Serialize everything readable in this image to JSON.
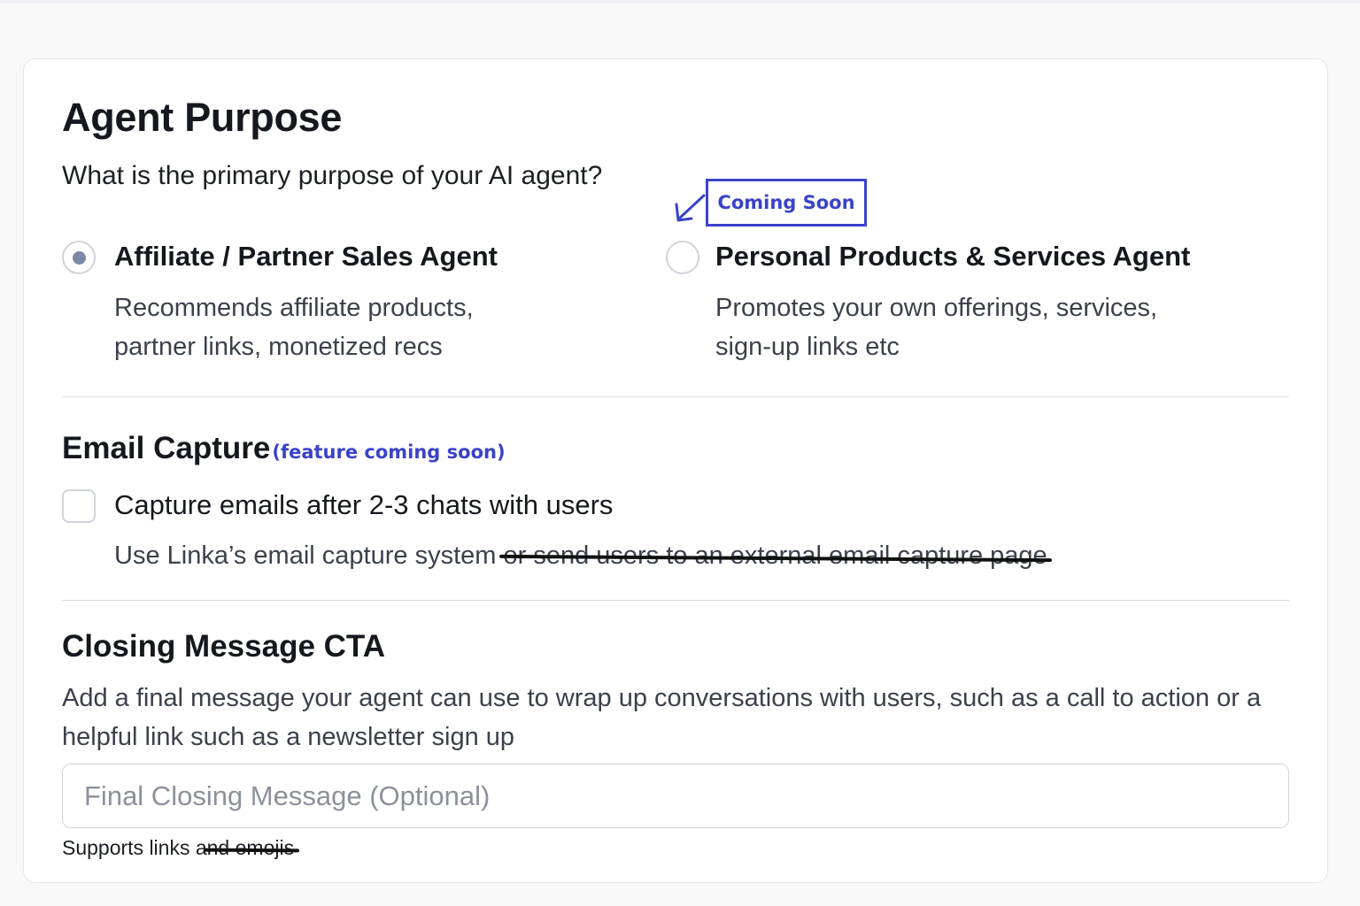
{
  "section_purpose": {
    "title": "Agent Purpose",
    "question": "What is the primary purpose of your AI agent?",
    "options": [
      {
        "title": "Affiliate / Partner Sales Agent",
        "desc_line1": "Recommends affiliate products,",
        "desc_line2": "partner links, monetized recs",
        "selected": true
      },
      {
        "title": "Personal Products & Services Agent",
        "desc_line1": "Promotes your own offerings, services,",
        "desc_line2": "sign-up links etc",
        "selected": false
      }
    ],
    "annotation": "Coming Soon"
  },
  "section_email": {
    "title": "Email Capture",
    "annotation": "(feature coming soon)",
    "checkbox_label": "Capture emails after 2-3 chats with users",
    "checked": false,
    "desc_plain": "Use Linka’s email capture system ",
    "desc_struck": "or send users to an external email capture page"
  },
  "section_cta": {
    "title": "Closing Message CTA",
    "desc": "Add a final message your agent can use to wrap up conversations with users, such as a call to action or a helpful link such as a newsletter sign up",
    "input_placeholder": "Final Closing Message (Optional)",
    "input_value": "",
    "hint_plain": "Supports links a",
    "hint_struck": "nd emojis"
  },
  "colors": {
    "annotation_blue": "#3a43c9",
    "radio_selected": "#7d87a6"
  }
}
